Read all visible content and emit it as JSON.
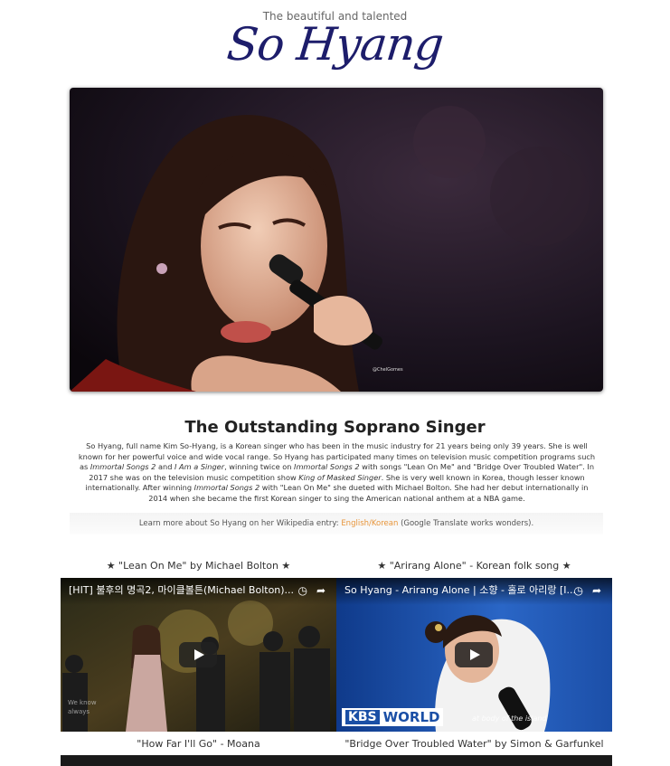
{
  "header": {
    "tagline": "The beautiful and talented",
    "logo": "So Hyang"
  },
  "hero": {
    "credit": "@ChelGomes"
  },
  "article": {
    "title": "The Outstanding Soprano Singer",
    "bio_1": "So Hyang, full name Kim So-Hyang, is a Korean singer who has been in the music industry for 21 years being only 39 years. She is well known for her powerful voice and wide vocal range. So Hyang has participated many times on television music competition programs such as ",
    "bio_em1": "Immortal Songs 2",
    "bio_2": " and ",
    "bio_em2": "I Am a Singer",
    "bio_3": ", winning twice on ",
    "bio_em3": "Immortal Songs 2",
    "bio_4": " with songs \"Lean On Me\" and \"Bridge Over Troubled Water\". In 2017 she was on the television music competition show ",
    "bio_em4": "King of Masked Singer",
    "bio_5": ". She is very well known in Korea, though lesser known internationally. After winning ",
    "bio_em5": "Immortal Songs 2",
    "bio_6": " with \"Lean On Me\" she dueted with Michael Bolton. She had her debut internationally in 2014 when she became the first Korean singer to sing the American national anthem at a NBA game.",
    "learn_prefix": "Learn more about So Hyang on her Wikipedia entry: ",
    "learn_link_en": "English",
    "learn_sep": "/",
    "learn_link_ko": "Korean",
    "learn_suffix": " (Google Translate works wonders)."
  },
  "videos": [
    {
      "heading": "★ \"Lean On Me\" by Michael Bolton ★",
      "title": "[HIT] 불후의 명곡2, 마이클볼튼(Michael Bolton)...",
      "caption_below": "\"How Far I'll Go\" - Moana"
    },
    {
      "heading": "★ \"Arirang Alone\" - Korean folk song ★",
      "title": "So Hyang - Arirang Alone | 소향 - 홀로 아리랑 [I...",
      "overlay_brand_1": "KBS",
      "overlay_brand_2": "WORLD",
      "overlay_subtitle": "at body of the island",
      "caption_below": "\"Bridge Over Troubled Water\" by Simon & Garfunkel"
    }
  ],
  "icons": {
    "clock": "clock-icon",
    "share": "share-icon",
    "play": "play-icon"
  }
}
